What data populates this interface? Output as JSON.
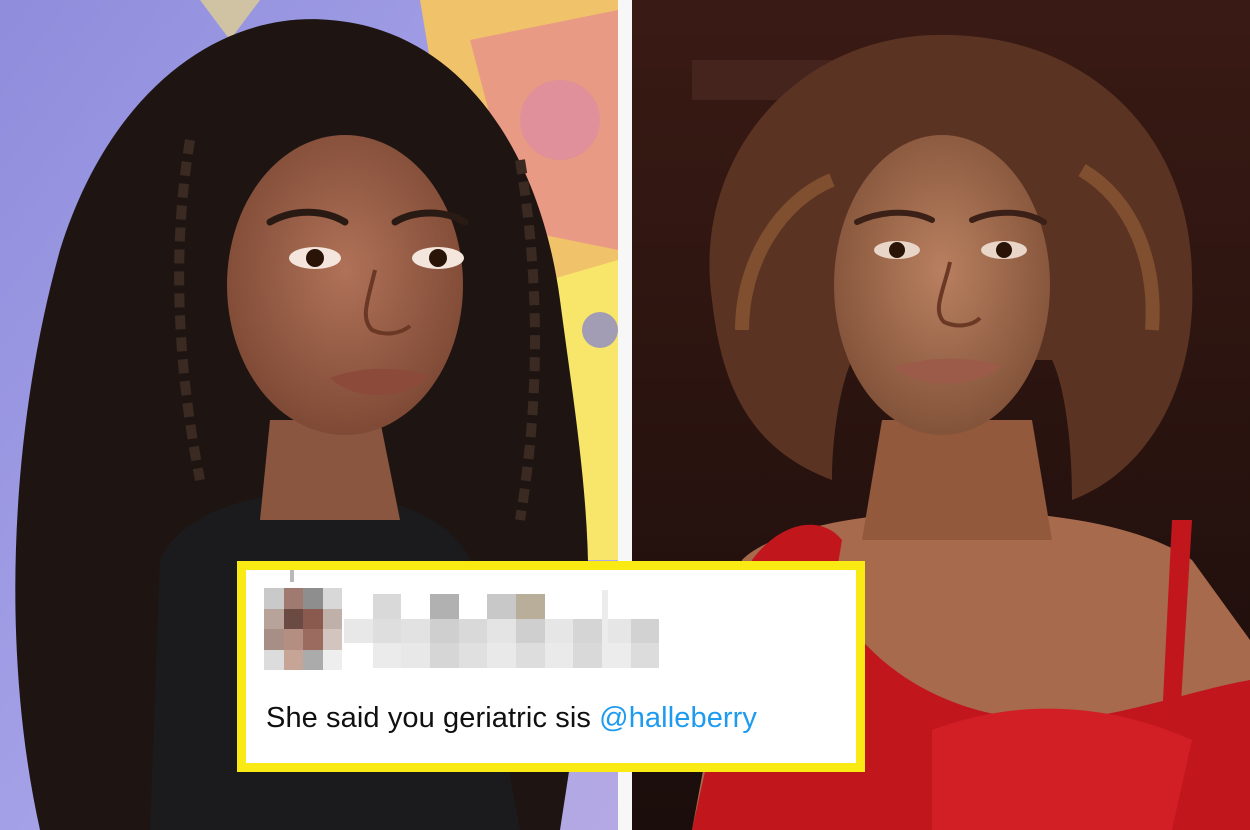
{
  "photos": {
    "left_alt": "",
    "right_alt": ""
  },
  "tweet": {
    "body": "She said you geriatric sis",
    "mention": "@halleberry",
    "avatar_pixel_colors": [
      "#c9c9c9",
      "#a07a70",
      "#8e8e8e",
      "#d8d8d8",
      "#b7a39a",
      "#6b4a44",
      "#8a5a4f",
      "#c0b0aa",
      "#a88f86",
      "#b48e80",
      "#9a6b5e",
      "#d2c4be",
      "#dcdcdc",
      "#c6a596",
      "#ababab",
      "#eeeeee"
    ],
    "name_pixel_colors": [
      "#ffffff",
      "#d9d9d9",
      "#ffffff",
      "#b1b1b1",
      "#ffffff",
      "#c8c8c8",
      "#b9ae9a",
      "#ffffff",
      "#ffffff",
      "#ffffff",
      "#ffffff",
      "#ffffff",
      "#e8e8e8",
      "#dedede",
      "#e2e2e2",
      "#cfcfcf",
      "#d9d9d9",
      "#e4e4e4",
      "#cfcfcf",
      "#e6e6e6",
      "#d5d5d5",
      "#e6e6e6",
      "#d2d2d2",
      "#ffffff",
      "#ffffff",
      "#ebebeb",
      "#e8e8e8",
      "#d6d6d6",
      "#e0e0e0",
      "#e9e9e9",
      "#dddddd",
      "#eaeaea",
      "#d9d9d9",
      "#ececec",
      "#dcdcdc",
      "#ffffff"
    ]
  },
  "colors": {
    "highlight_border": "#f8ea12",
    "mention": "#1d9bf0"
  }
}
